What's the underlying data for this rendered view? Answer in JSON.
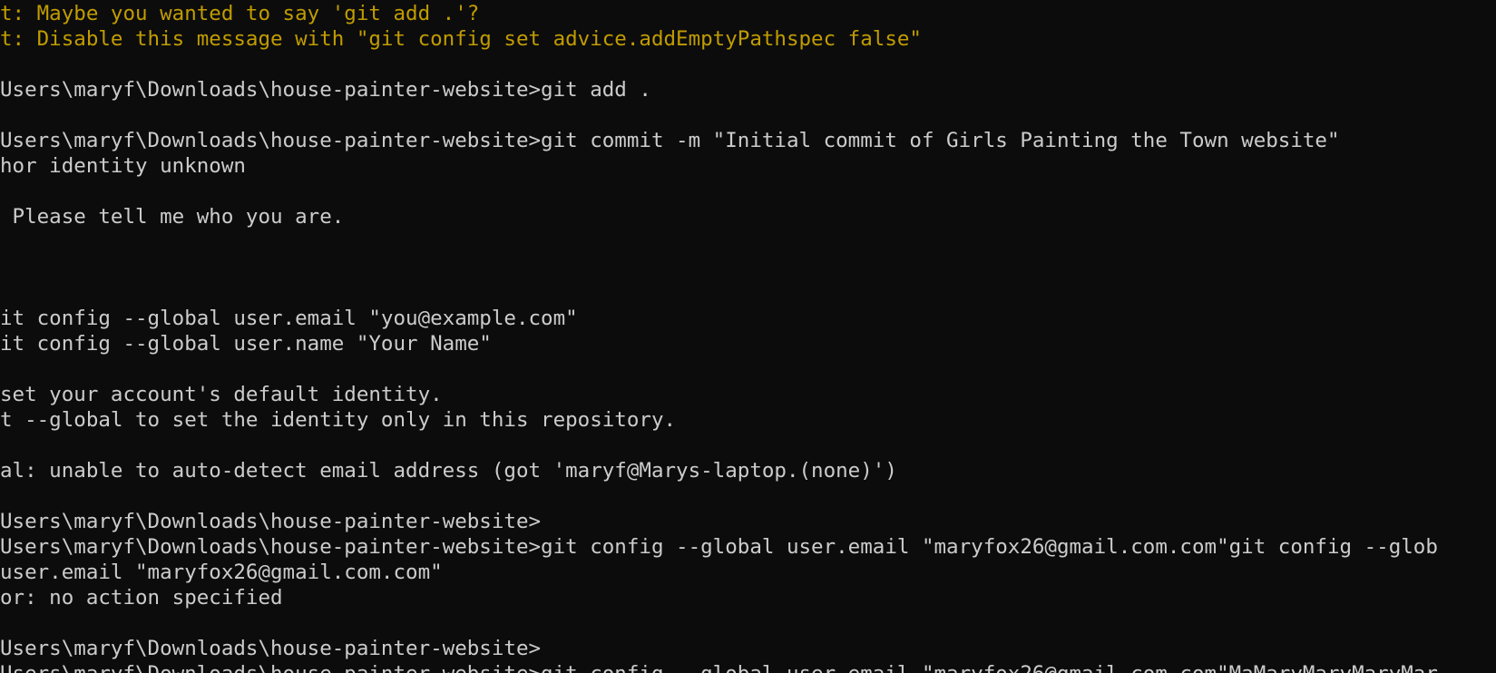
{
  "terminal": {
    "lines": [
      {
        "text": "t: Maybe you wanted to say 'git add .'?",
        "kind": "warn"
      },
      {
        "text": "t: Disable this message with \"git config set advice.addEmptyPathspec false\"",
        "kind": "warn"
      },
      {
        "text": "",
        "kind": "normal"
      },
      {
        "text": "Users\\maryf\\Downloads\\house-painter-website>git add .",
        "kind": "normal"
      },
      {
        "text": "",
        "kind": "normal"
      },
      {
        "text": "Users\\maryf\\Downloads\\house-painter-website>git commit -m \"Initial commit of Girls Painting the Town website\"",
        "kind": "normal"
      },
      {
        "text": "hor identity unknown",
        "kind": "normal"
      },
      {
        "text": "",
        "kind": "normal"
      },
      {
        "text": " Please tell me who you are.",
        "kind": "normal"
      },
      {
        "text": "",
        "kind": "normal"
      },
      {
        "text": "",
        "kind": "normal"
      },
      {
        "text": "",
        "kind": "normal"
      },
      {
        "text": "it config --global user.email \"you@example.com\"",
        "kind": "normal"
      },
      {
        "text": "it config --global user.name \"Your Name\"",
        "kind": "normal"
      },
      {
        "text": "",
        "kind": "normal"
      },
      {
        "text": "set your account's default identity.",
        "kind": "normal"
      },
      {
        "text": "t --global to set the identity only in this repository.",
        "kind": "normal"
      },
      {
        "text": "",
        "kind": "normal"
      },
      {
        "text": "al: unable to auto-detect email address (got 'maryf@Marys-laptop.(none)')",
        "kind": "normal"
      },
      {
        "text": "",
        "kind": "normal"
      },
      {
        "text": "Users\\maryf\\Downloads\\house-painter-website>",
        "kind": "normal"
      },
      {
        "text": "Users\\maryf\\Downloads\\house-painter-website>git config --global user.email \"maryfox26@gmail.com.com\"git config --glob",
        "kind": "normal"
      },
      {
        "text": "user.email \"maryfox26@gmail.com.com\"",
        "kind": "normal"
      },
      {
        "text": "or: no action specified",
        "kind": "normal"
      },
      {
        "text": "",
        "kind": "normal"
      },
      {
        "text": "Users\\maryf\\Downloads\\house-painter-website>",
        "kind": "normal"
      },
      {
        "text": "Users\\maryf\\Downloads\\house-painter-website>git config --global user.email \"maryfox26@gmail.com.com\"MaMaryMaryMaryMar",
        "kind": "normal"
      }
    ]
  },
  "colors": {
    "background": "#0c0c0c",
    "text": "#cccccc",
    "warning": "#c19c00"
  }
}
